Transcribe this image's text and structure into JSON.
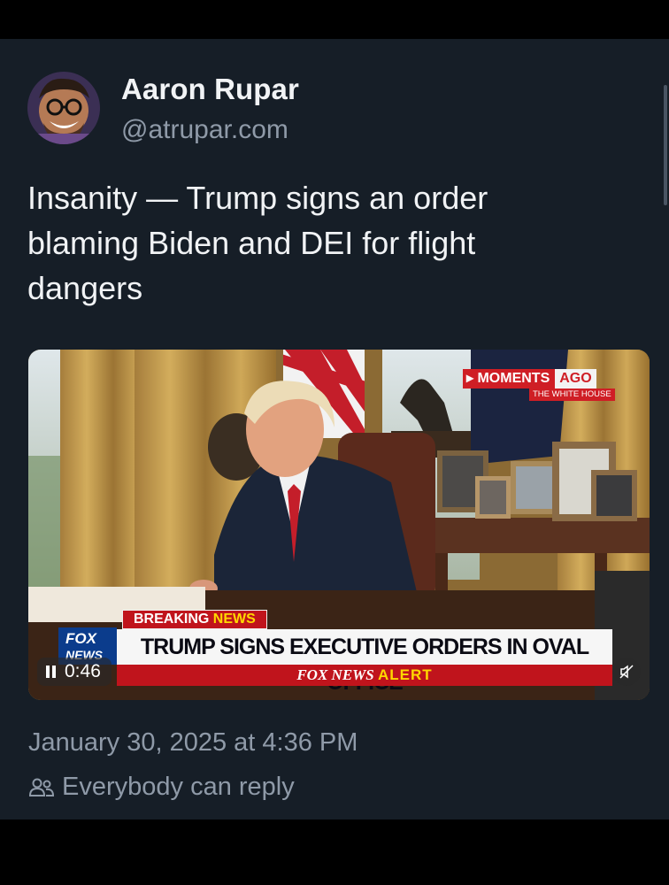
{
  "post": {
    "author": {
      "display_name": "Aaron Rupar",
      "handle": "@atrupar.com"
    },
    "text": "Insanity — Trump signs an order\nblaming Biden and DEI for flight\ndangers",
    "video": {
      "overlay": {
        "moments_prefix": "▸ MOMENTS",
        "moments_suffix": "AGO",
        "source": "THE WHITE HOUSE",
        "breaking_prefix": "BREAKING",
        "breaking_news": "NEWS",
        "network_line1": "FOX",
        "network_line2": "NEWS",
        "headline": "TRUMP SIGNS EXECUTIVE ORDERS IN OVAL OFFICE",
        "alert_network": "FOX NEWS",
        "alert_word": "ALERT"
      },
      "duration": "0:46",
      "playback_icon": "pause-icon",
      "mute_icon": "speaker-muted-icon"
    },
    "timestamp": "January 30, 2025 at 4:36 PM",
    "reply_setting": "Everybody can reply",
    "reply_icon": "people-icon"
  },
  "colors": {
    "background": "#161e27",
    "primary_text": "#f1f3f5",
    "secondary_text": "#8f9aa8",
    "fox_red": "#c0141c",
    "fox_yellow": "#ffd800"
  }
}
